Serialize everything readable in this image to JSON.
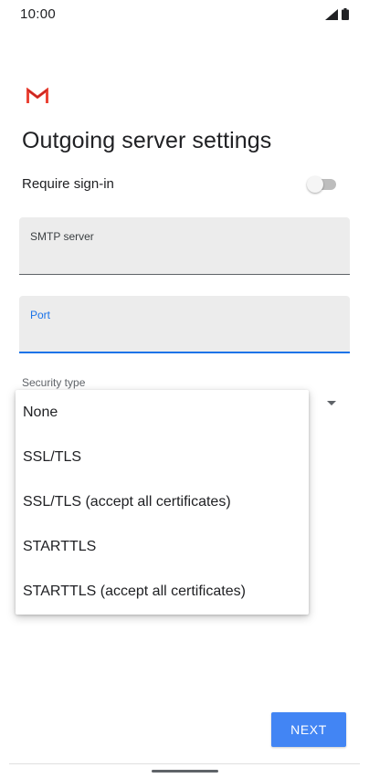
{
  "status_bar": {
    "time": "10:00",
    "icons": [
      "signal-icon",
      "battery-icon"
    ]
  },
  "app": {
    "logo_icon": "gmail-logo-icon",
    "brand_color": "#EA4335"
  },
  "page": {
    "title": "Outgoing server settings"
  },
  "require_signin": {
    "label": "Require sign-in",
    "enabled": false
  },
  "fields": {
    "smtp_server": {
      "label": "SMTP server",
      "value": ""
    },
    "port": {
      "label": "Port",
      "value": "",
      "focused": true
    }
  },
  "security": {
    "label": "Security type",
    "options": [
      "None",
      "SSL/TLS",
      "SSL/TLS (accept all certificates)",
      "STARTTLS",
      "STARTTLS (accept all certificates)"
    ]
  },
  "actions": {
    "next_label": "NEXT",
    "accent_color": "#4285F4"
  }
}
